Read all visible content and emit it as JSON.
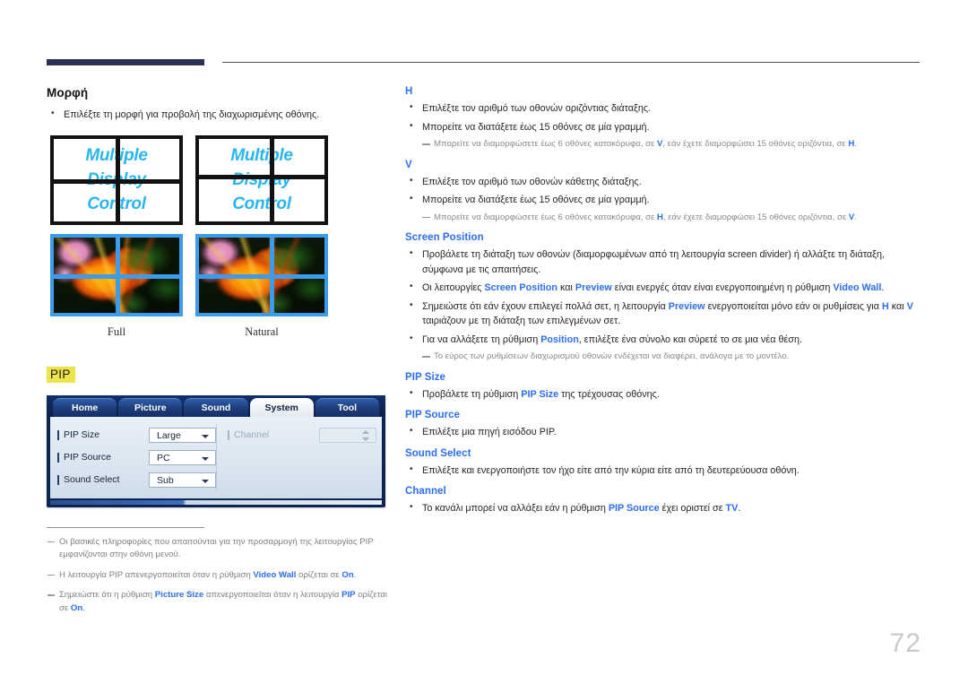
{
  "page": {
    "number": "72"
  },
  "left": {
    "section_title": "Μορφή",
    "bullets": [
      "Επιλέξτε τη μορφή για προβολή της διαχωρισμένης οθόνης."
    ],
    "figures": [
      {
        "wall_text": [
          "Multiple",
          "Display",
          "Control"
        ],
        "caption": "Full"
      },
      {
        "wall_text": [
          "Multiple",
          "Display",
          "Control"
        ],
        "caption": "Natural"
      }
    ],
    "pip_badge": "PIP",
    "osd": {
      "tabs": [
        {
          "label": "Home",
          "active": false
        },
        {
          "label": "Picture",
          "active": false
        },
        {
          "label": "Sound",
          "active": false
        },
        {
          "label": "System",
          "active": true
        },
        {
          "label": "Tool",
          "active": false
        }
      ],
      "rows_left": [
        {
          "label": "PIP Size",
          "value": "Large"
        },
        {
          "label": "PIP Source",
          "value": "PC"
        },
        {
          "label": "Sound Select",
          "value": "Sub"
        }
      ],
      "rows_right": [
        {
          "label": "Channel",
          "value": ""
        }
      ]
    },
    "footnotes": [
      {
        "parts": [
          {
            "t": "Οι βασικές πληροφορίες που απαιτούνται για την προσαρμογή της λειτουργίας PIP εμφανίζονται στην οθόνη μενού.",
            "kw": false
          }
        ]
      },
      {
        "parts": [
          {
            "t": "Η λειτουργία PIP απενεργοποιείται όταν η ρύθμιση ",
            "kw": false
          },
          {
            "t": "Video Wall",
            "kw": true
          },
          {
            "t": " ορίζεται σε ",
            "kw": false
          },
          {
            "t": "On",
            "kw": true
          },
          {
            "t": ".",
            "kw": false
          }
        ]
      },
      {
        "parts": [
          {
            "t": "Σημειώστε ότι η ρύθμιση ",
            "kw": false
          },
          {
            "t": "Picture Size",
            "kw": true
          },
          {
            "t": " απενεργοποιείται όταν η λειτουργία ",
            "kw": false
          },
          {
            "t": "PIP",
            "kw": true
          },
          {
            "t": " ορίζεται σε ",
            "kw": false
          },
          {
            "t": "On",
            "kw": true
          },
          {
            "t": ".",
            "kw": false
          }
        ]
      }
    ]
  },
  "right": {
    "sections": [
      {
        "heading": "H",
        "items": [
          {
            "type": "bullet",
            "parts": [
              {
                "t": "Επιλέξτε τον αριθμό των οθονών οριζόντιας διάταξης.",
                "kw": false
              }
            ]
          },
          {
            "type": "bullet",
            "parts": [
              {
                "t": "Μπορείτε να διατάξετε έως 15 οθόνες σε μία γραμμή.",
                "kw": false
              }
            ]
          },
          {
            "type": "note",
            "parts": [
              {
                "t": "Μπορείτε να διαμορφώσετε έως 6 οθόνες κατακόρυφα, σε ",
                "kw": false
              },
              {
                "t": "V",
                "kw": true
              },
              {
                "t": ", εάν έχετε διαμορφώσει 15 οθόνες οριζόντια, σε ",
                "kw": false
              },
              {
                "t": "H",
                "kw": true
              },
              {
                "t": ".",
                "kw": false
              }
            ]
          }
        ]
      },
      {
        "heading": "V",
        "items": [
          {
            "type": "bullet",
            "parts": [
              {
                "t": "Επιλέξτε τον αριθμό των οθονών κάθετης διάταξης.",
                "kw": false
              }
            ]
          },
          {
            "type": "bullet",
            "parts": [
              {
                "t": "Μπορείτε να διατάξετε έως 15 οθόνες σε μία γραμμή.",
                "kw": false
              }
            ]
          },
          {
            "type": "note",
            "parts": [
              {
                "t": "Μπορείτε να διαμορφώσετε έως 6 οθόνες κατακόρυφα, σε ",
                "kw": false
              },
              {
                "t": "H",
                "kw": true
              },
              {
                "t": ", εάν έχετε διαμορφώσει 15 οθόνες οριζόντια, σε ",
                "kw": false
              },
              {
                "t": "V",
                "kw": true
              },
              {
                "t": ".",
                "kw": false
              }
            ]
          }
        ]
      },
      {
        "heading": "Screen Position",
        "items": [
          {
            "type": "bullet",
            "parts": [
              {
                "t": "Προβάλετε τη διάταξη των οθονών (διαμορφωμένων από τη λειτουργία screen divider) ή αλλάξτε τη διάταξη, σύμφωνα με τις απαιτήσεις.",
                "kw": false
              }
            ]
          },
          {
            "type": "bullet",
            "parts": [
              {
                "t": "Οι λειτουργίες ",
                "kw": false
              },
              {
                "t": "Screen Position",
                "kw": true
              },
              {
                "t": " και ",
                "kw": false
              },
              {
                "t": "Preview",
                "kw": true
              },
              {
                "t": " είναι ενεργές όταν είναι ενεργοποιημένη η ρύθμιση ",
                "kw": false
              },
              {
                "t": "Video Wall",
                "kw": true
              },
              {
                "t": ".",
                "kw": false
              }
            ]
          },
          {
            "type": "bullet",
            "parts": [
              {
                "t": "Σημειώστε ότι εάν έχουν επιλεγεί πολλά σετ, η λειτουργία ",
                "kw": false
              },
              {
                "t": "Preview",
                "kw": true
              },
              {
                "t": " ενεργοποιείται μόνο εάν οι ρυθμίσεις για ",
                "kw": false
              },
              {
                "t": "H",
                "kw": true
              },
              {
                "t": " και ",
                "kw": false
              },
              {
                "t": "V",
                "kw": true
              },
              {
                "t": " ταιριάζουν με τη διάταξη των επιλεγμένων σετ.",
                "kw": false
              }
            ]
          },
          {
            "type": "bullet",
            "parts": [
              {
                "t": "Για να αλλάξετε τη ρύθμιση ",
                "kw": false
              },
              {
                "t": "Position",
                "kw": true
              },
              {
                "t": ", επιλέξτε ένα σύνολο και σύρετέ το σε μια νέα θέση.",
                "kw": false
              }
            ]
          },
          {
            "type": "note",
            "parts": [
              {
                "t": "Το εύρος των ρυθμίσεων διαχωρισμού οθονών ενδέχεται να διαφέρει, ανάλογα με το μοντέλο.",
                "kw": false
              }
            ]
          }
        ]
      },
      {
        "heading": "PIP Size",
        "items": [
          {
            "type": "bullet",
            "parts": [
              {
                "t": "Προβάλετε τη ρύθμιση ",
                "kw": false
              },
              {
                "t": "PIP Size",
                "kw": true
              },
              {
                "t": " της τρέχουσας οθόνης.",
                "kw": false
              }
            ]
          }
        ]
      },
      {
        "heading": "PIP Source",
        "items": [
          {
            "type": "bullet",
            "parts": [
              {
                "t": "Επιλέξτε μια πηγή εισόδου PIP.",
                "kw": false
              }
            ]
          }
        ]
      },
      {
        "heading": "Sound Select",
        "items": [
          {
            "type": "bullet",
            "parts": [
              {
                "t": "Επιλέξτε και ενεργοποιήστε τον ήχο είτε από την κύρια είτε από τη δευτερεύουσα οθόνη.",
                "kw": false
              }
            ]
          }
        ]
      },
      {
        "heading": "Channel",
        "items": [
          {
            "type": "bullet",
            "parts": [
              {
                "t": "Το κανάλι μπορεί να αλλάξει εάν η ρύθμιση ",
                "kw": false
              },
              {
                "t": "PIP Source",
                "kw": true
              },
              {
                "t": " έχει οριστεί σε ",
                "kw": false
              },
              {
                "t": "TV",
                "kw": true
              },
              {
                "t": ".",
                "kw": false
              }
            ]
          }
        ]
      }
    ]
  },
  "colors": {
    "accent_blue": "#2b6fee",
    "header_bar": "#2d3155",
    "badge_yellow": "#ece44b",
    "note_gray": "#8a8a8a",
    "wall_text_cyan": "#29b6f0",
    "photo_border": "#3c9bea"
  }
}
